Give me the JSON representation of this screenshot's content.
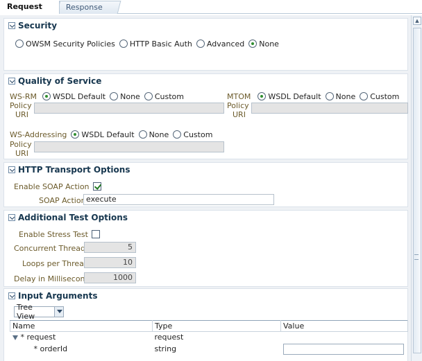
{
  "tabs": [
    {
      "label": "Request"
    },
    {
      "label": "Response"
    }
  ],
  "security": {
    "title": "Security",
    "options": [
      "OWSM Security Policies",
      "HTTP Basic Auth",
      "Advanced",
      "None"
    ],
    "selected": "None"
  },
  "qos": {
    "title": "Quality of Service",
    "wsrm_label": "WS-RM",
    "mtom_label": "MTOM",
    "wsaddr_label": "WS-Addressing",
    "policy_label": "Policy",
    "uri_label": "URI",
    "options": [
      "WSDL Default",
      "None",
      "Custom"
    ],
    "wsrm_selected": "WSDL Default",
    "mtom_selected": "WSDL Default",
    "wsaddr_selected": "WSDL Default"
  },
  "http": {
    "title": "HTTP Transport Options",
    "enable_soap_label": "Enable SOAP Action",
    "enable_soap_checked": true,
    "soap_action_label": "SOAP Action",
    "soap_action_value": "execute"
  },
  "test": {
    "title": "Additional Test Options",
    "stress_label": "Enable Stress Test",
    "stress_checked": false,
    "threads_label": "Concurrent Threads",
    "threads_value": "5",
    "loops_label": "Loops per Thread",
    "loops_value": "10",
    "delay_label": "Delay in Milliseconds",
    "delay_value": "1000"
  },
  "inputs": {
    "title": "Input Arguments",
    "view_select": "Tree View",
    "columns": [
      "Name",
      "Type",
      "Value"
    ],
    "rows": [
      {
        "name": "* request",
        "type": "request",
        "value": ""
      },
      {
        "name": "* orderId",
        "type": "string",
        "value": ""
      }
    ]
  },
  "colors": {
    "accent": "#17374f",
    "radio_on": "#2f8e2f",
    "label": "#6b5a2a"
  }
}
